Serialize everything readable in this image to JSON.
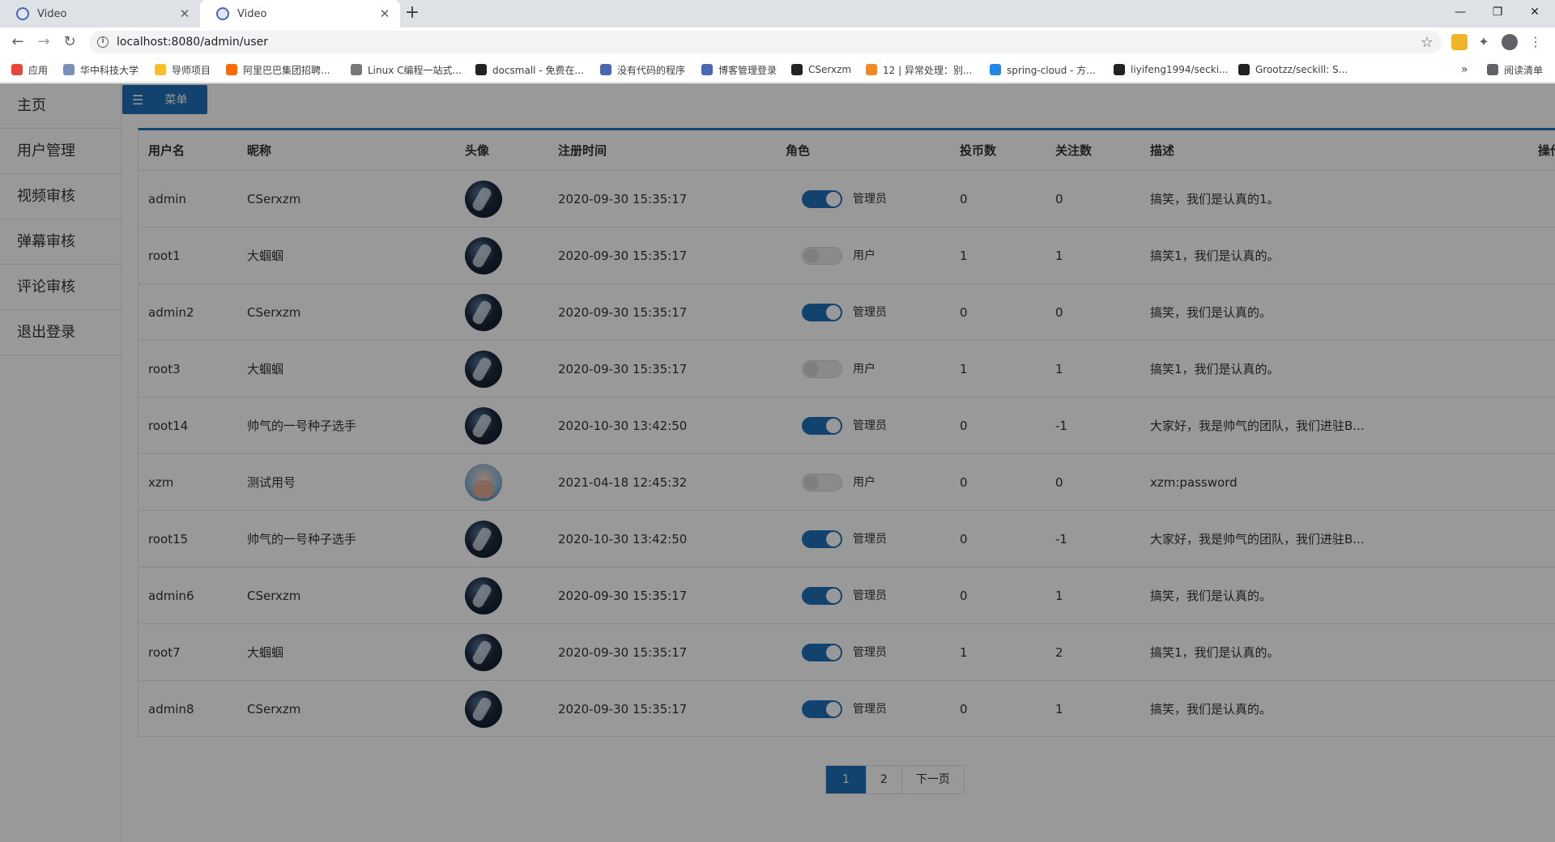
{
  "browser": {
    "tabs": [
      {
        "title": "Video"
      },
      {
        "title": "Video"
      }
    ],
    "url": "localhost:8080/admin/user",
    "bookmarks": [
      {
        "label": "应用",
        "color": "#e8453c"
      },
      {
        "label": "华中科技大学",
        "color": "#7a8fb8"
      },
      {
        "label": "导师项目",
        "color": "#f6c026"
      },
      {
        "label": "阿里巴巴集团招聘...",
        "color": "#ff6a00"
      },
      {
        "label": "Linux C编程一站式...",
        "color": "#777777"
      },
      {
        "label": "docsmall - 免费在...",
        "color": "#222222"
      },
      {
        "label": "没有代码的程序",
        "color": "#4a67b3"
      },
      {
        "label": "博客管理登录",
        "color": "#4a67b3"
      },
      {
        "label": "CSerxzm",
        "color": "#222222"
      },
      {
        "label": "12 | 异常处理：别...",
        "color": "#f08a24"
      },
      {
        "label": "spring-cloud - 方...",
        "color": "#1e88e5"
      },
      {
        "label": "liyifeng1994/secki...",
        "color": "#222222"
      },
      {
        "label": "Grootzz/seckill: S...",
        "color": "#222222"
      },
      {
        "label": "阅读清单",
        "color": "#5f6368"
      }
    ]
  },
  "sidebar": {
    "items": [
      {
        "label": "主页"
      },
      {
        "label": "用户管理"
      },
      {
        "label": "视频审核"
      },
      {
        "label": "弹幕审核"
      },
      {
        "label": "评论审核"
      },
      {
        "label": "退出登录"
      }
    ]
  },
  "main": {
    "menu_label": "菜单",
    "columns": [
      "用户名",
      "昵称",
      "头像",
      "注册时间",
      "角色",
      "投币数",
      "关注数",
      "描述",
      "操作"
    ],
    "rows": [
      {
        "username": "admin",
        "nickname": "CSerxzm",
        "registered": "2020-09-30 15:35:17",
        "admin": true,
        "role": "管理员",
        "coins": "0",
        "follows": "0",
        "desc": "搞笑，我们是认真的1。",
        "avatar": "dark"
      },
      {
        "username": "root1",
        "nickname": "大蝈蝈",
        "registered": "2020-09-30 15:35:17",
        "admin": false,
        "role": "用户",
        "coins": "1",
        "follows": "1",
        "desc": "搞笑1，我们是认真的。",
        "avatar": "dark"
      },
      {
        "username": "admin2",
        "nickname": "CSerxzm",
        "registered": "2020-09-30 15:35:17",
        "admin": true,
        "role": "管理员",
        "coins": "0",
        "follows": "0",
        "desc": "搞笑，我们是认真的。",
        "avatar": "dark"
      },
      {
        "username": "root3",
        "nickname": "大蝈蝈",
        "registered": "2020-09-30 15:35:17",
        "admin": false,
        "role": "用户",
        "coins": "1",
        "follows": "1",
        "desc": "搞笑1，我们是认真的。",
        "avatar": "dark"
      },
      {
        "username": "root14",
        "nickname": "帅气的一号种子选手",
        "registered": "2020-10-30 13:42:50",
        "admin": true,
        "role": "管理员",
        "coins": "0",
        "follows": "-1",
        "desc": "大家好，我是帅气的团队，我们进驻B...",
        "avatar": "dark"
      },
      {
        "username": "xzm",
        "nickname": "测试用号",
        "registered": "2021-04-18 12:45:32",
        "admin": false,
        "role": "用户",
        "coins": "0",
        "follows": "0",
        "desc": "xzm:password",
        "avatar": "light"
      },
      {
        "username": "root15",
        "nickname": "帅气的一号种子选手",
        "registered": "2020-10-30 13:42:50",
        "admin": true,
        "role": "管理员",
        "coins": "0",
        "follows": "-1",
        "desc": "大家好，我是帅气的团队，我们进驻B...",
        "avatar": "dark"
      },
      {
        "username": "admin6",
        "nickname": "CSerxzm",
        "registered": "2020-09-30 15:35:17",
        "admin": true,
        "role": "管理员",
        "coins": "0",
        "follows": "1",
        "desc": "搞笑，我们是认真的。",
        "avatar": "dark"
      },
      {
        "username": "root7",
        "nickname": "大蝈蝈",
        "registered": "2020-09-30 15:35:17",
        "admin": true,
        "role": "管理员",
        "coins": "1",
        "follows": "2",
        "desc": "搞笑1，我们是认真的。",
        "avatar": "dark"
      },
      {
        "username": "admin8",
        "nickname": "CSerxzm",
        "registered": "2020-09-30 15:35:17",
        "admin": true,
        "role": "管理员",
        "coins": "0",
        "follows": "1",
        "desc": "搞笑，我们是认真的。",
        "avatar": "dark"
      }
    ],
    "pagination": {
      "pages": [
        "1",
        "2"
      ],
      "current": "1",
      "next_label": "下一页"
    }
  },
  "colors": {
    "accent": "#1e6fb8",
    "danger": "#c9252b",
    "overlay": "rgba(0,0,0,0.4)"
  }
}
